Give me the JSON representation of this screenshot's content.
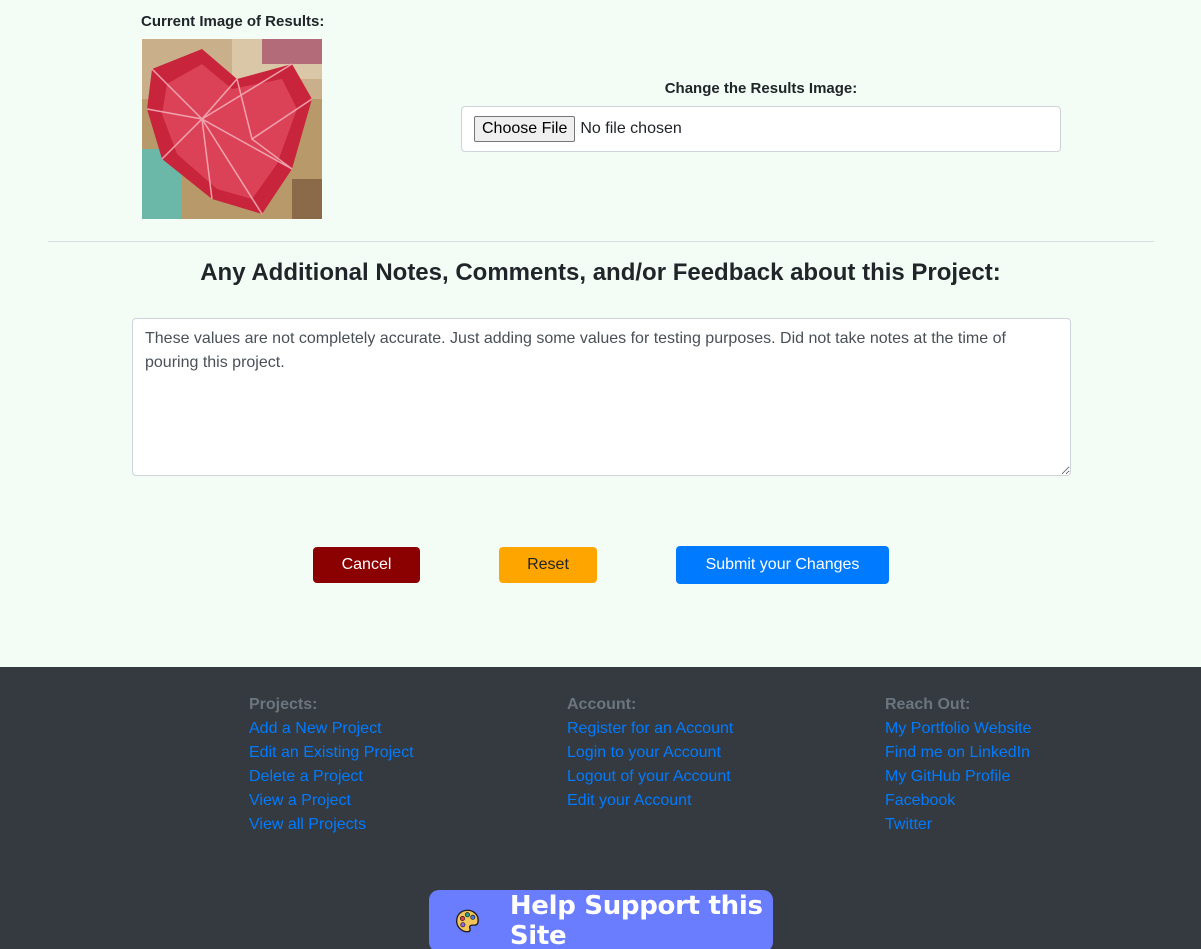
{
  "current_image": {
    "label": "Current Image of Results:"
  },
  "change_image": {
    "label": "Change the Results Image:",
    "button_label": "Choose File",
    "status": "No file chosen"
  },
  "notes": {
    "heading": "Any Additional Notes, Comments, and/or Feedback about this Project:",
    "value": "These values are not completely accurate. Just adding some values for testing purposes. Did not take notes at the time of pouring this project."
  },
  "actions": {
    "cancel": "Cancel",
    "reset": "Reset",
    "submit": "Submit your Changes"
  },
  "colors": {
    "page_bg": "#f3fdf6",
    "cancel": "#8b0000",
    "reset": "#ffa500",
    "submit": "#007bff",
    "footer_bg": "#343a40",
    "link": "#007bff",
    "support_bg": "#6b7dff"
  },
  "footer": {
    "projects": {
      "title": "Projects:",
      "links": [
        "Add a New Project",
        "Edit an Existing Project",
        "Delete a Project",
        "View a Project",
        "View all Projects"
      ]
    },
    "account": {
      "title": "Account:",
      "links": [
        "Register for an Account",
        "Login to your Account",
        "Logout of your Account",
        "Edit your Account"
      ]
    },
    "reach_out": {
      "title": "Reach Out:",
      "links": [
        "My Portfolio Website",
        "Find me on LinkedIn",
        "My GitHub Profile",
        "Facebook",
        "Twitter"
      ]
    }
  },
  "support": {
    "icon": "palette-icon",
    "label": "Help Support this Site"
  }
}
